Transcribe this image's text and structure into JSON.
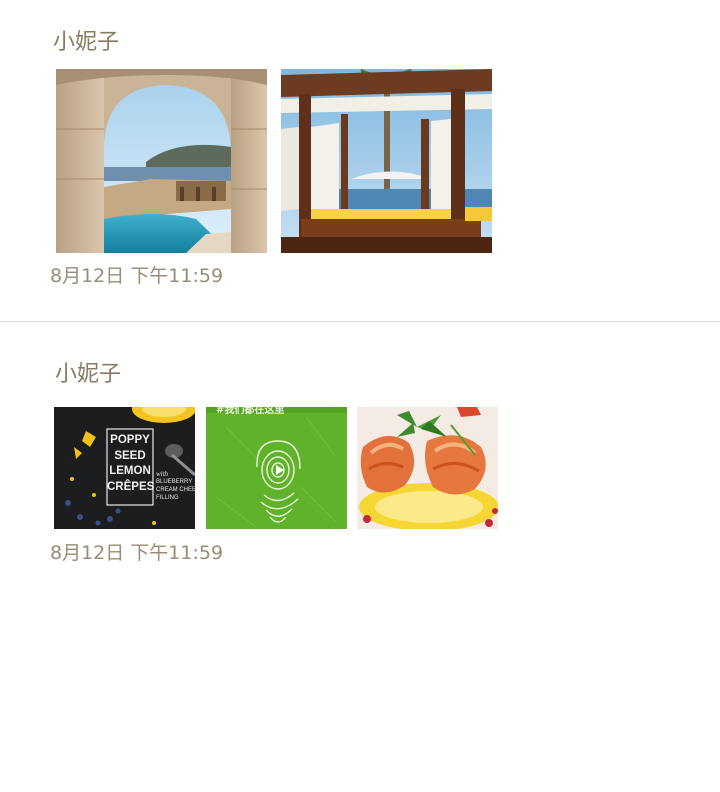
{
  "posts": [
    {
      "author": "小妮子",
      "time": "8月12日  下午11:59",
      "photos": [
        {
          "name": "photo-villa-arch-pool",
          "alt": "archway overlooking pool and sea"
        },
        {
          "name": "photo-cabana-beds",
          "alt": "wooden cabana with white curtains"
        }
      ]
    },
    {
      "author": "小妮子",
      "time": "8月12日  下午11:59",
      "photos": [
        {
          "name": "photo-lemon-crepes",
          "alt": "poppy seed lemon crepes poster",
          "poster_lines": [
            "POPPY",
            "SEED",
            "LEMON",
            "CRÊPES"
          ],
          "side_lines": [
            "with",
            "BLUEBERRY",
            "CREAM CHEESE",
            "FILLING"
          ]
        },
        {
          "name": "photo-green-video",
          "alt": "green fingerprint video",
          "banner": "#我们都在这里"
        },
        {
          "name": "photo-shrimp",
          "alt": "grilled shrimp on lemon"
        }
      ]
    }
  ],
  "colors": {
    "author": "#8a7a62",
    "time": "#9a8c74",
    "divider": "#dddddd",
    "background": "#ffffff"
  }
}
